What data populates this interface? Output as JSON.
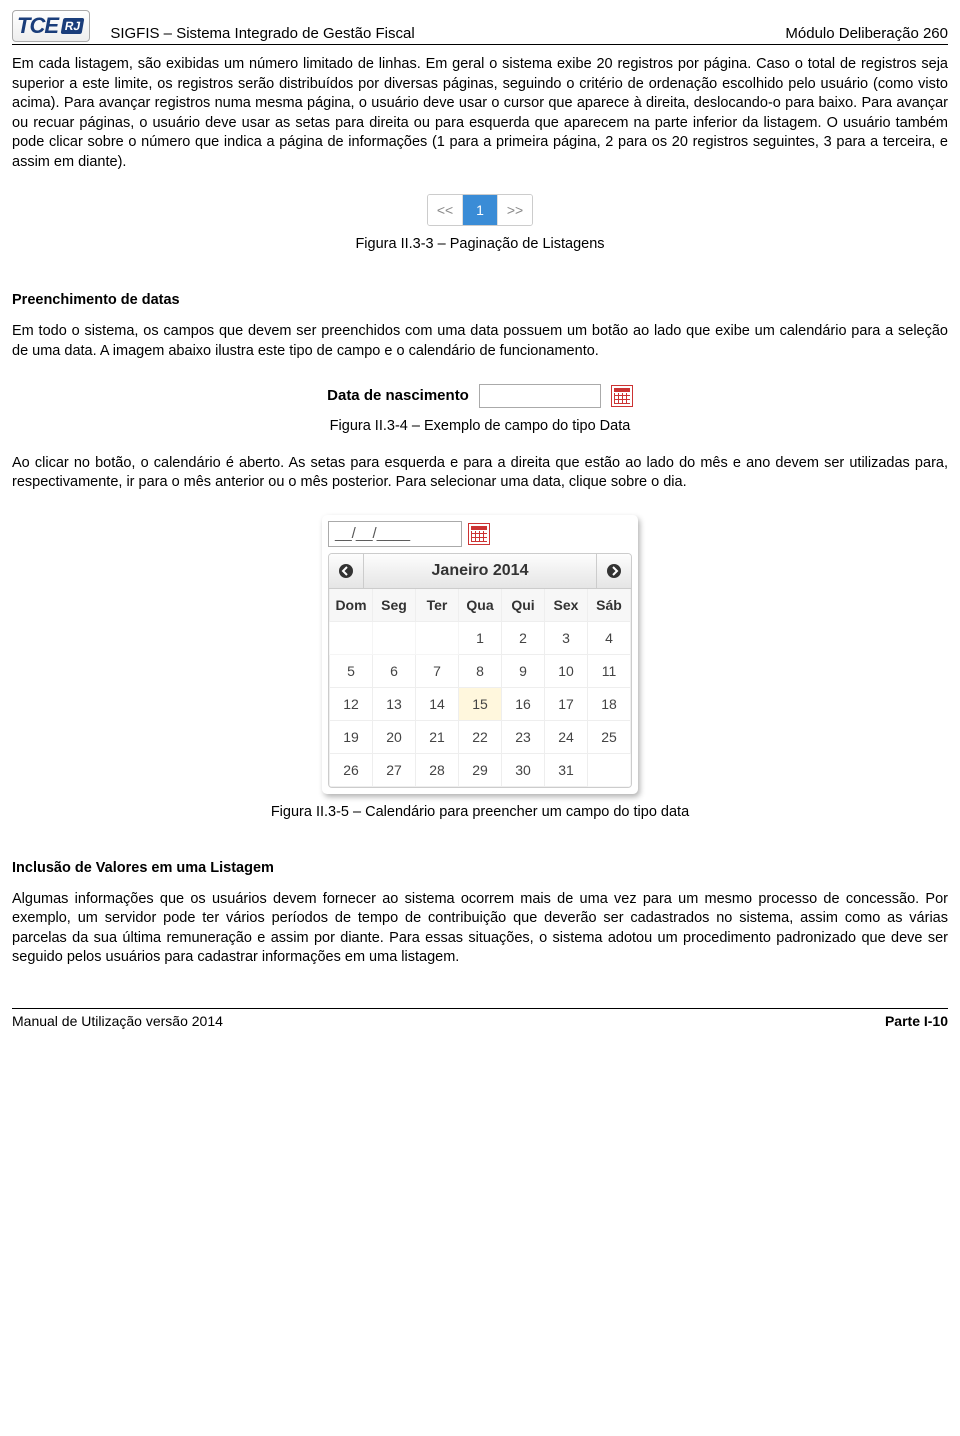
{
  "header": {
    "logo_text": "TCE",
    "logo_badge": "RJ",
    "system_title": "SIGFIS – Sistema Integrado de Gestão Fiscal",
    "module_title": "Módulo Deliberação 260"
  },
  "paragraphs": {
    "p1": "Em cada listagem, são exibidas um número limitado de linhas. Em geral o sistema exibe 20 registros por página. Caso o total de registros seja superior a este limite, os registros serão distribuídos por diversas páginas, seguindo o critério de ordenação escolhido pelo usuário (como visto acima). Para avançar registros numa mesma página, o usuário deve usar o cursor que aparece à direita, deslocando-o para baixo. Para avançar ou recuar páginas, o usuário deve usar as setas para direita ou para esquerda que aparecem na parte inferior da listagem. O usuário também pode clicar sobre o número que indica a página de informações (1 para a primeira página, 2 para os 20 registros seguintes, 3 para a terceira, e assim em diante).",
    "p2_heading": "Preenchimento de datas",
    "p2": "Em todo o sistema, os campos que devem ser preenchidos com uma data possuem um botão ao lado que exibe um calendário para a seleção de uma data. A imagem abaixo ilustra este tipo de campo e o calendário de funcionamento.",
    "p3": "Ao clicar no botão, o calendário é aberto. As setas para esquerda e para a direita que estão ao lado do mês e ano devem ser utilizadas para, respectivamente, ir para o mês anterior ou o mês posterior. Para selecionar uma data, clique sobre o dia.",
    "p4_heading": "Inclusão de Valores em uma Listagem",
    "p4": "Algumas informações que os usuários devem fornecer ao sistema ocorrem mais de uma vez para um mesmo processo de concessão. Por exemplo, um servidor pode ter vários períodos de tempo de contribuição que deverão ser cadastrados no sistema, assim como as várias parcelas da sua última remuneração e assim por diante. Para essas situações, o sistema adotou um procedimento padronizado que deve ser seguido pelos usuários para cadastrar informações em uma listagem."
  },
  "figures": {
    "pagination": {
      "prev": "<<",
      "page": "1",
      "next": ">>",
      "caption": "Figura II.3-3 – Paginação de Listagens"
    },
    "date_field": {
      "label": "Data de nascimento",
      "caption": "Figura II.3-4 – Exemplo de campo do tipo Data"
    },
    "calendar": {
      "input_placeholder": "__/__/____",
      "title": "Janeiro 2014",
      "weekdays": [
        "Dom",
        "Seg",
        "Ter",
        "Qua",
        "Qui",
        "Sex",
        "Sáb"
      ],
      "rows": [
        [
          "",
          "",
          "",
          "1",
          "2",
          "3",
          "4"
        ],
        [
          "5",
          "6",
          "7",
          "8",
          "9",
          "10",
          "11"
        ],
        [
          "12",
          "13",
          "14",
          "15",
          "16",
          "17",
          "18"
        ],
        [
          "19",
          "20",
          "21",
          "22",
          "23",
          "24",
          "25"
        ],
        [
          "26",
          "27",
          "28",
          "29",
          "30",
          "31",
          ""
        ]
      ],
      "highlight": "15",
      "caption": "Figura II.3-5 – Calendário para preencher um campo do tipo data"
    }
  },
  "footer": {
    "left": "Manual de Utilização versão 2014",
    "right": "Parte I-10"
  }
}
